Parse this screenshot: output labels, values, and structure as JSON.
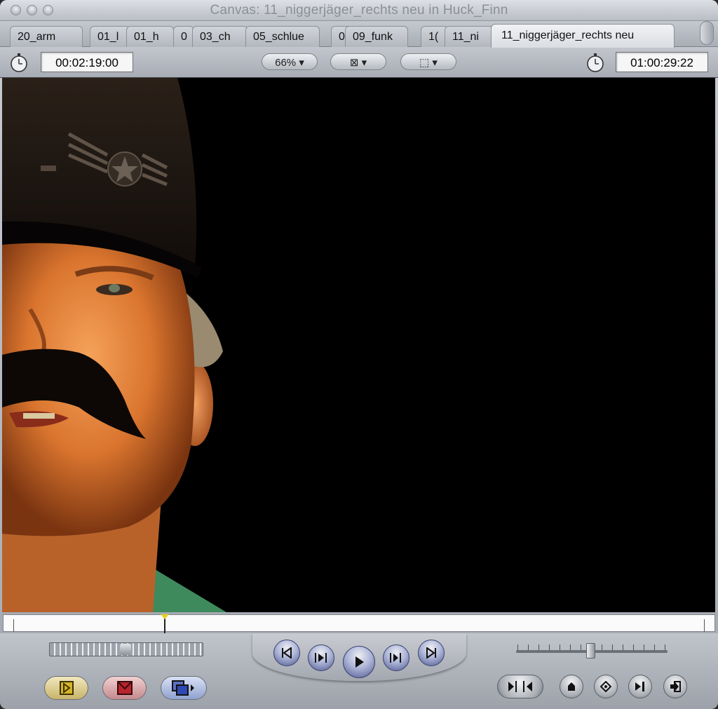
{
  "window": {
    "title": "Canvas: 11_niggerjäger_rechts neu in Huck_Finn"
  },
  "tabs": [
    {
      "label": "20_arm"
    },
    {
      "label": "01_l"
    },
    {
      "label": "01_h"
    },
    {
      "label": "0"
    },
    {
      "label": "03_ch"
    },
    {
      "label": "05_schlue"
    },
    {
      "label": "0"
    },
    {
      "label": "09_funk"
    },
    {
      "label": "1("
    },
    {
      "label": "11_ni"
    },
    {
      "label": "11_niggerjäger_rechts neu"
    }
  ],
  "toolbar": {
    "duration_timecode": "00:02:19:00",
    "zoom_label": "66%",
    "view_label": "⊠",
    "display_label": "⬚",
    "current_timecode": "01:00:29:22"
  },
  "icons": {
    "duration": "stopwatch-icon",
    "current": "stopwatch-icon",
    "play": "play-icon",
    "mark_in": "mark-in-icon",
    "mark_out": "mark-out-icon",
    "add_marker": "marker-icon",
    "add_keyframe": "keyframe-icon",
    "insert": "insert-edit-icon",
    "overwrite": "overwrite-edit-icon",
    "replace": "replace-edit-icon"
  },
  "colors": {
    "insert_button": "#e8d99a",
    "overwrite_button": "#d7a1a5",
    "replace_button": "#9fb1da",
    "playhead_marker": "#e7d21f",
    "transport_blue": "#6b76b5"
  }
}
